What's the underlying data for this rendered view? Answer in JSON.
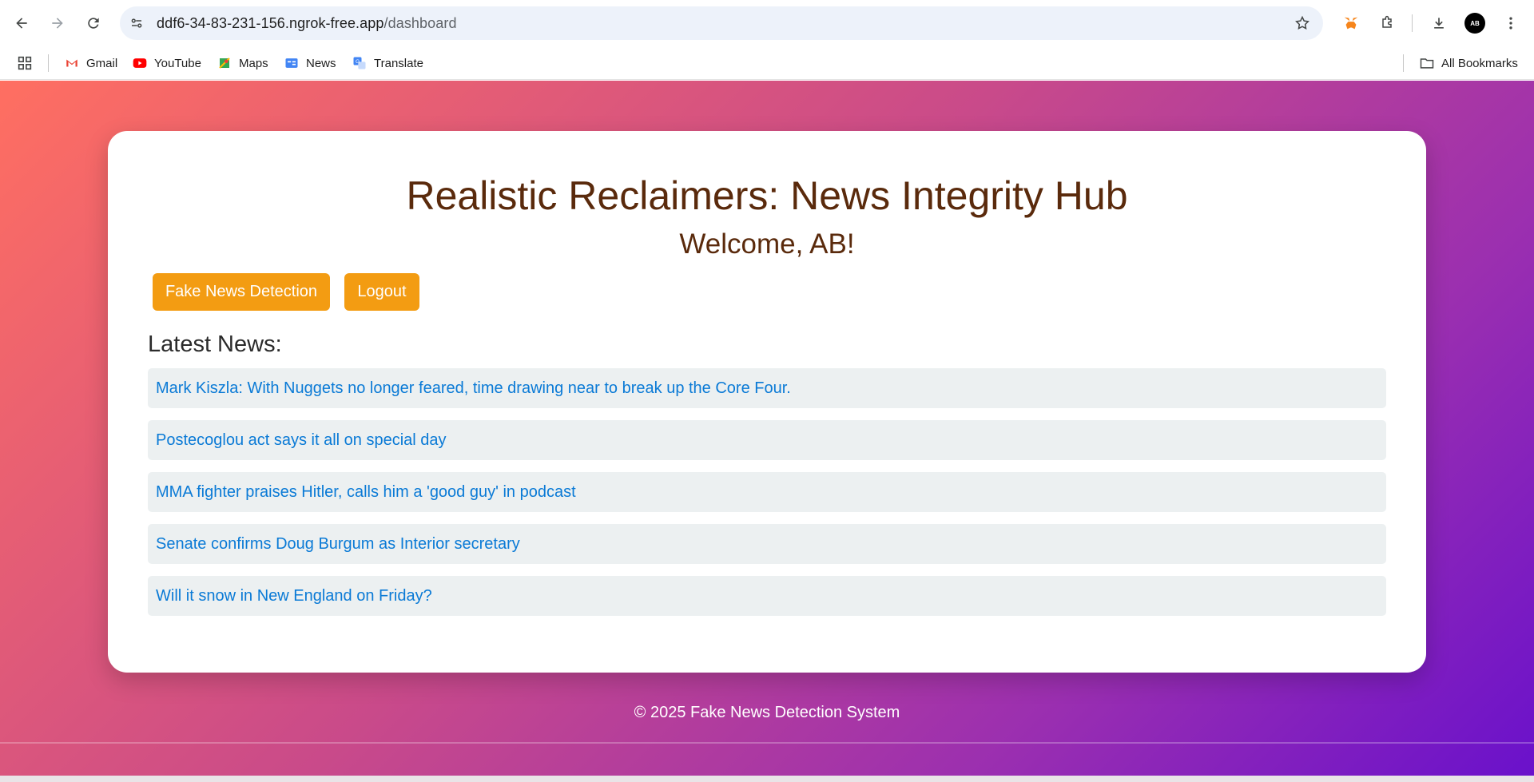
{
  "browser": {
    "url_host": "ddf6-34-83-231-156.ngrok-free.app",
    "url_path": "/dashboard",
    "avatar_initials": "AB",
    "bookmarks": [
      {
        "label": "Gmail",
        "icon": "gmail-icon"
      },
      {
        "label": "YouTube",
        "icon": "youtube-icon"
      },
      {
        "label": "Maps",
        "icon": "maps-icon"
      },
      {
        "label": "News",
        "icon": "news-icon"
      },
      {
        "label": "Translate",
        "icon": "translate-icon"
      }
    ],
    "all_bookmarks_label": "All Bookmarks"
  },
  "page": {
    "title": "Realistic Reclaimers: News Integrity Hub",
    "welcome": "Welcome, AB!",
    "buttons": {
      "detect": "Fake News Detection",
      "logout": "Logout"
    },
    "latest_heading": "Latest News:",
    "news": [
      "Mark Kiszla: With Nuggets no longer feared, time drawing near to break up the Core Four.",
      "Postecoglou act says it all on special day",
      "MMA fighter praises Hitler, calls him a 'good guy' in podcast",
      "Senate confirms Doug Burgum as Interior secretary",
      "Will it snow in New England on Friday?"
    ],
    "footer": "© 2025 Fake News Detection System"
  },
  "colors": {
    "gradient_start": "#ff6f61",
    "gradient_end": "#6a11cb",
    "button": "#f39c12",
    "title_text": "#5a2a0c",
    "link": "#0a7ad6",
    "news_bg": "#ecf0f1"
  }
}
